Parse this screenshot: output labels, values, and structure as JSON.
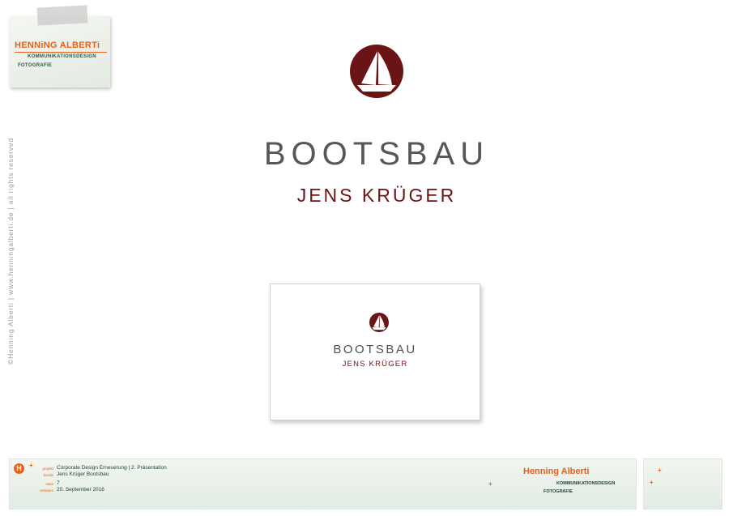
{
  "sticky_note": {
    "brand": "HENNiNG ALBERTi",
    "line1": "KOMMUNIKATIONSDESIGN",
    "line2": "FOTOGRAFIE"
  },
  "copyright_vertical": "©Henning Alberti  |  www.henningalberti.de  |  all rights reserved",
  "logo": {
    "title": "BOOTSBAU",
    "subtitle": "JENS KRÜGER",
    "emblem_color": "#6b1416",
    "title_color": "#575757"
  },
  "business_card": {
    "title": "BOOTSBAU",
    "subtitle": "JENS KRÜGER"
  },
  "footer": {
    "badge": "H",
    "rows": [
      {
        "label": "projekt",
        "value": "Corporate Design Erneuerung  |  2. Präsentation"
      },
      {
        "label": "kunde",
        "value": "Jens Krüger Bootsbau"
      },
      {
        "label": "seite",
        "value": "7"
      },
      {
        "label": "zeitraum",
        "value": "20. September 2016"
      }
    ],
    "brand": "Henning Alberti",
    "line1": "KOMMUNIKATIONSDESIGN",
    "line2": "FOTOGRAFIE",
    "accent_color": "#e8601c"
  }
}
